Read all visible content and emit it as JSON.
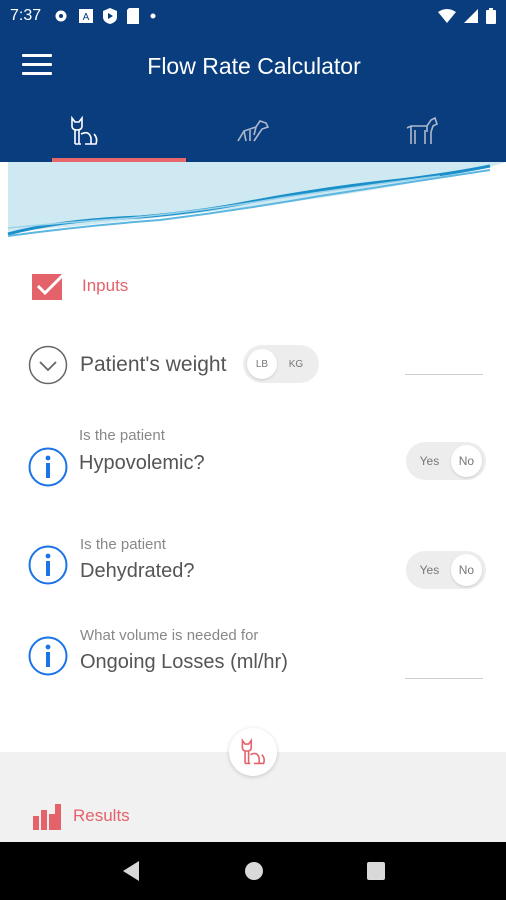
{
  "status_bar": {
    "time": "7:37",
    "left_icons": [
      "settings-icon",
      "a-icon",
      "shield-play-icon",
      "sim-icon",
      "dot-icon"
    ],
    "right_icons": [
      "wifi-icon",
      "signal-icon",
      "battery-icon"
    ]
  },
  "app_bar": {
    "title": "Flow Rate Calculator",
    "menu_icon": "menu-icon"
  },
  "tabs": [
    {
      "name": "cat",
      "icon": "cat-icon",
      "selected": true
    },
    {
      "name": "dog",
      "icon": "dog-icon",
      "selected": false
    },
    {
      "name": "horse",
      "icon": "horse-icon",
      "selected": false
    }
  ],
  "colors": {
    "primary": "#0a3d7e",
    "accent": "#e4626a",
    "info_blue": "#1a73e8"
  },
  "inputs": {
    "section_label": "Inputs",
    "weight": {
      "label": "Patient's weight",
      "unit_lb": "LB",
      "unit_kg": "KG",
      "value": ""
    },
    "hypovolemic": {
      "prompt": "Is the patient",
      "label": "Hypovolemic?",
      "yes": "Yes",
      "no": "No",
      "selected": "No"
    },
    "dehydrated": {
      "prompt": "Is the patient",
      "label": "Dehydrated?",
      "yes": "Yes",
      "no": "No",
      "selected": "No"
    },
    "ongoing_losses": {
      "prompt": "What volume is needed for",
      "label": "Ongoing Losses (ml/hr)",
      "value": ""
    }
  },
  "results": {
    "section_label": "Results"
  },
  "nav_bar": {
    "icons": [
      "back-icon",
      "home-icon",
      "recents-icon"
    ]
  }
}
